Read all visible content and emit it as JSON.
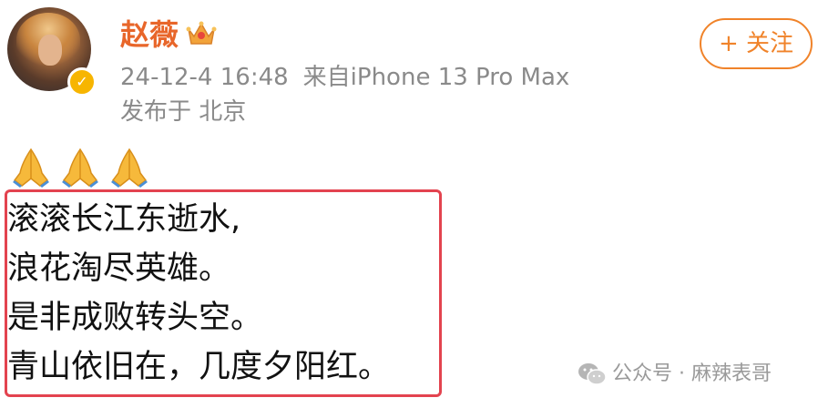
{
  "post": {
    "username": "赵薇",
    "timestamp": "24-12-4 16:48",
    "source": "来自iPhone 13 Pro Max",
    "location": "发布于 北京",
    "follow_label": "+ 关注",
    "verified_mark": "✓",
    "emoji": [
      "pray-icon",
      "pray-icon",
      "pray-icon"
    ],
    "poem_lines": [
      "滚滚长江东逝水,",
      "浪花淘尽英雄。",
      "是非成败转头空。",
      "青山依旧在，几度夕阳红。"
    ]
  },
  "watermark": {
    "text": "公众号 · 麻辣表哥"
  },
  "colors": {
    "username": "#e8662a",
    "follow": "#f0832a",
    "highlight_border": "#e3434f",
    "meta_text": "#8a8a8a",
    "verified": "#f7b500"
  }
}
